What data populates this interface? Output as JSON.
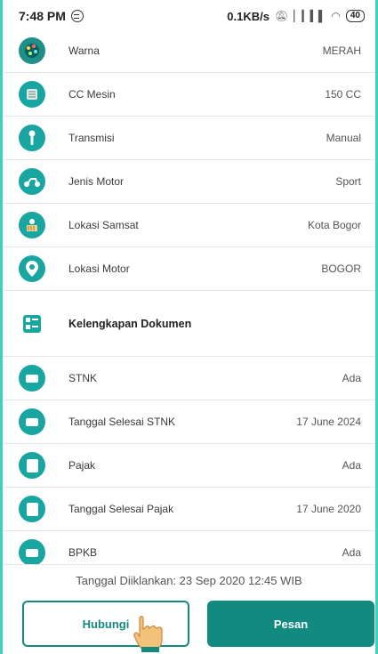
{
  "status_bar": {
    "time": "7:48 PM",
    "net_speed": "0.1KB/s",
    "battery": "40"
  },
  "details": [
    {
      "label": "Warna",
      "value": "MERAH",
      "icon": "color-palette-icon"
    },
    {
      "label": "CC Mesin",
      "value": "150 CC",
      "icon": "engine-icon"
    },
    {
      "label": "Transmisi",
      "value": "Manual",
      "icon": "gear-shift-icon"
    },
    {
      "label": "Jenis Motor",
      "value": "Sport",
      "icon": "motorcycle-icon"
    },
    {
      "label": "Lokasi Samsat",
      "value": "Kota Bogor",
      "icon": "office-building-icon"
    },
    {
      "label": "Lokasi Motor",
      "value": "BOGOR",
      "icon": "location-pin-icon"
    }
  ],
  "documents_section": {
    "title": "Kelengkapan Dokumen",
    "icon": "checklist-icon"
  },
  "documents": [
    {
      "label": "STNK",
      "value": "Ada",
      "icon": "card-icon"
    },
    {
      "label": "Tanggal Selesai STNK",
      "value": "17 June 2024",
      "icon": "card-icon"
    },
    {
      "label": "Pajak",
      "value": "Ada",
      "icon": "document-icon"
    },
    {
      "label": "Tanggal Selesai Pajak",
      "value": "17 June 2020",
      "icon": "document-icon"
    },
    {
      "label": "BPKB",
      "value": "Ada",
      "icon": "card-icon"
    }
  ],
  "footer": {
    "posted_label": "Tanggal Diiklankan: 23 Sep 2020 12:45 WIB",
    "contact_label": "Hubungi",
    "order_label": "Pesan"
  },
  "colors": {
    "accent": "#128a80",
    "icon_bg": "#1aa6a0",
    "frame": "#3fd0c0"
  }
}
